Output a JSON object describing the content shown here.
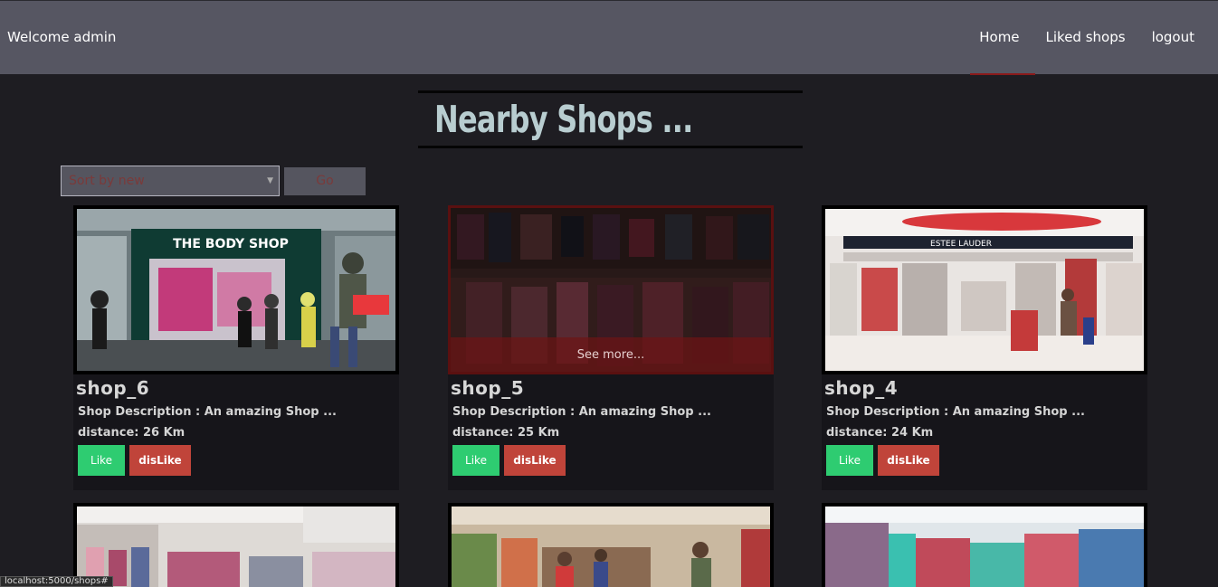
{
  "navbar": {
    "welcome": "Welcome admin",
    "links": [
      {
        "label": "Home"
      },
      {
        "label": "Liked shops"
      },
      {
        "label": "logout"
      }
    ]
  },
  "page_title": "Nearby Shops ...",
  "sort": {
    "selected": "Sort by new",
    "go_label": "Go"
  },
  "shops": [
    {
      "name": "shop_6",
      "description": "Shop Description : An amazing Shop ...",
      "distance": "distance: 26 Km",
      "image_icon": "storefront-image",
      "image_text": "THE BODY SHOP"
    },
    {
      "name": "shop_5",
      "description": "Shop Description : An amazing Shop ...",
      "distance": "distance: 25 Km",
      "image_icon": "clothing-rack-image",
      "see_more": "See more..."
    },
    {
      "name": "shop_4",
      "description": "Shop Description : An amazing Shop ...",
      "distance": "distance: 24 Km",
      "image_icon": "cosmetics-store-image",
      "image_text": "ESTEE LAUDER"
    }
  ],
  "buttons": {
    "like": "Like",
    "dislike": "disLike"
  },
  "more_cards": [
    {
      "image_icon": "clothing-store-image"
    },
    {
      "image_icon": "grocery-counter-image"
    },
    {
      "image_icon": "convenience-store-image"
    }
  ],
  "status_url": "localhost:5000/shops#",
  "colors": {
    "navbar": "#565662",
    "background": "#1e1d22",
    "like": "#2ecc71",
    "dislike": "#c0443a",
    "title": "#b8cdd0"
  }
}
